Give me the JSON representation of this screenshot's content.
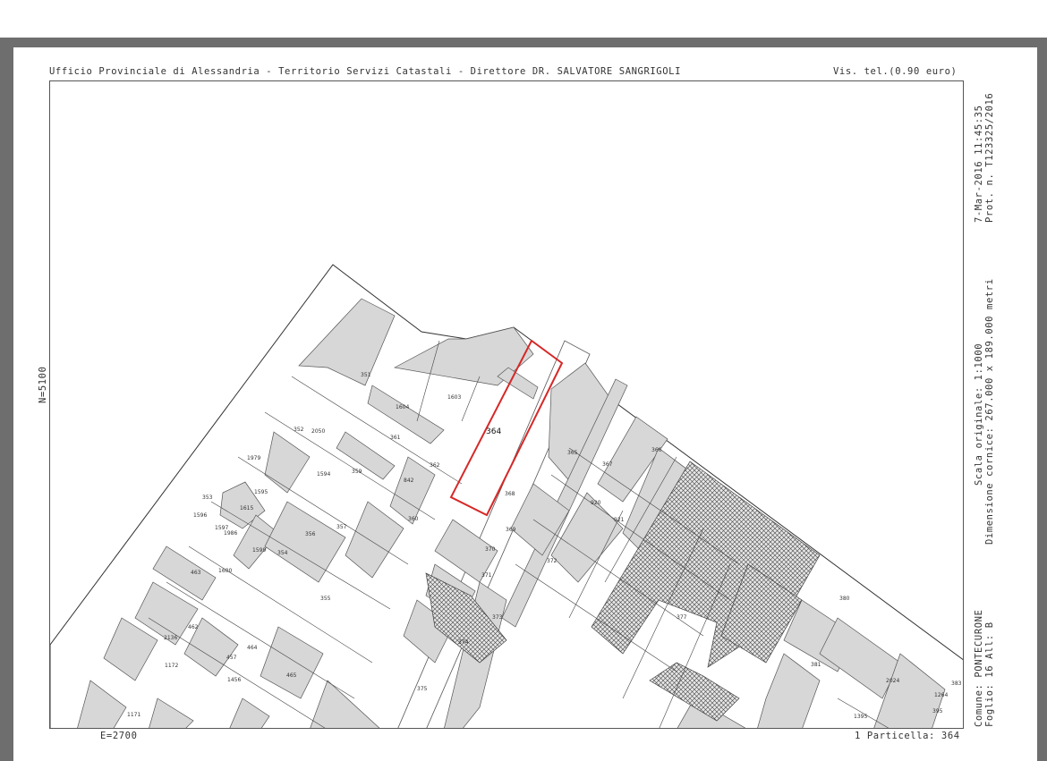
{
  "header": {
    "office": "Ufficio Provinciale di Alessandria - Territorio Servizi Catastali - Direttore DR. SALVATORE SANGRIGOLI",
    "fee": "Vis. tel.(0.90 euro)"
  },
  "side_right": {
    "datetime": "7-Mar-2016 11:45:35",
    "protocol": "Prot. n. T123325/2016",
    "scale": "Scala originale: 1:1000",
    "frame": "Dimensione cornice: 267.000 x 189.000 metri",
    "comune": "Comune: PONTECURONE",
    "foglio": "Foglio: 16 All: B"
  },
  "side_left": {
    "north_coord": "N=5100"
  },
  "footer": {
    "east_coord": "E=2700",
    "particelle": "1 Particella: 364"
  },
  "parcels": {
    "highlighted": "364",
    "colors": {
      "highlight": "#d62828",
      "building": "#d7d7d7",
      "line": "#444444"
    },
    "labels": [
      "351",
      "2050",
      "1603",
      "1604",
      "352",
      "361",
      "362",
      "1979",
      "1594",
      "359",
      "842",
      "353",
      "1595",
      "1615",
      "1596",
      "1597",
      "1986",
      "360",
      "357",
      "356",
      "1599",
      "354",
      "463",
      "1600",
      "355",
      "462",
      "2136",
      "457",
      "464",
      "1172",
      "1456",
      "465",
      "1171",
      "365",
      "367",
      "366",
      "368",
      "369",
      "920",
      "921",
      "370",
      "371",
      "372",
      "373",
      "374",
      "375",
      "377",
      "380",
      "381",
      "2024",
      "1395",
      "1264",
      "395",
      "383"
    ]
  }
}
